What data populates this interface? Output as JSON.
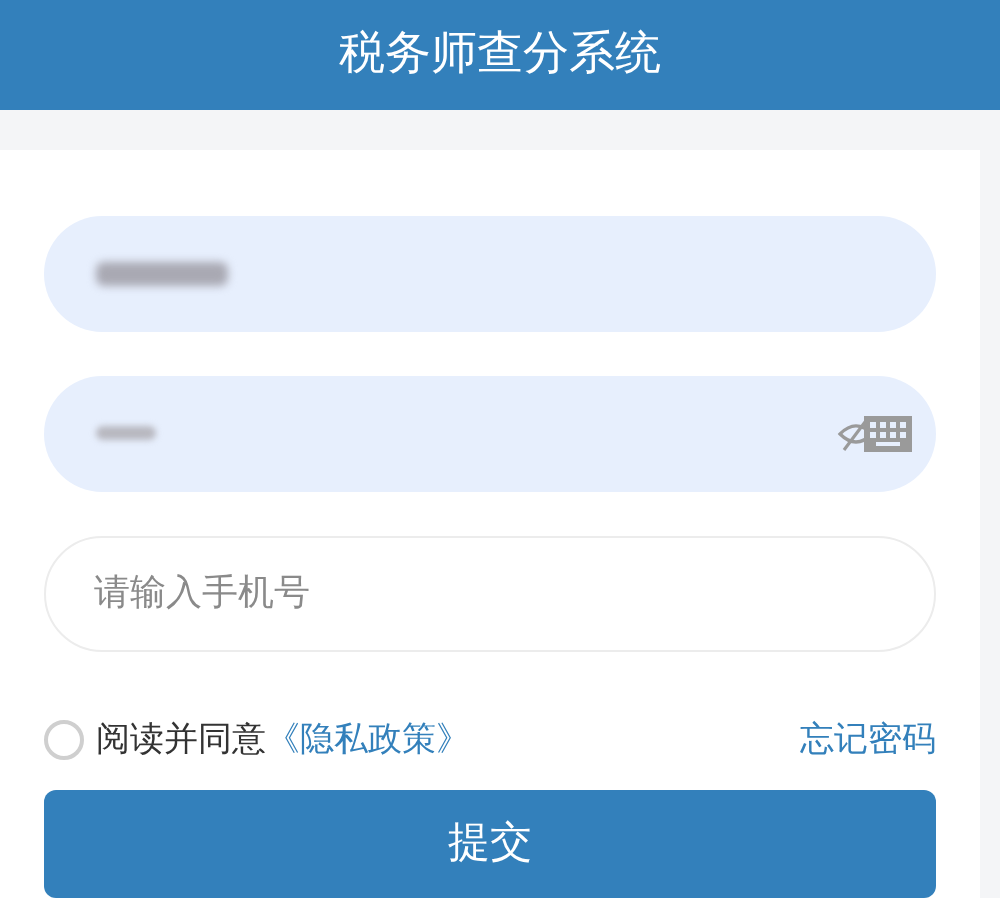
{
  "header": {
    "title": "税务师查分系统"
  },
  "fields": [
    {
      "kind": "redacted"
    },
    {
      "kind": "redacted_password"
    },
    {
      "kind": "text",
      "placeholder": "请输入手机号"
    }
  ],
  "agreement": {
    "checked": false,
    "text": "阅读并同意",
    "link": "《隐私政策》"
  },
  "forgot_password": "忘记密码",
  "submit": "提交"
}
